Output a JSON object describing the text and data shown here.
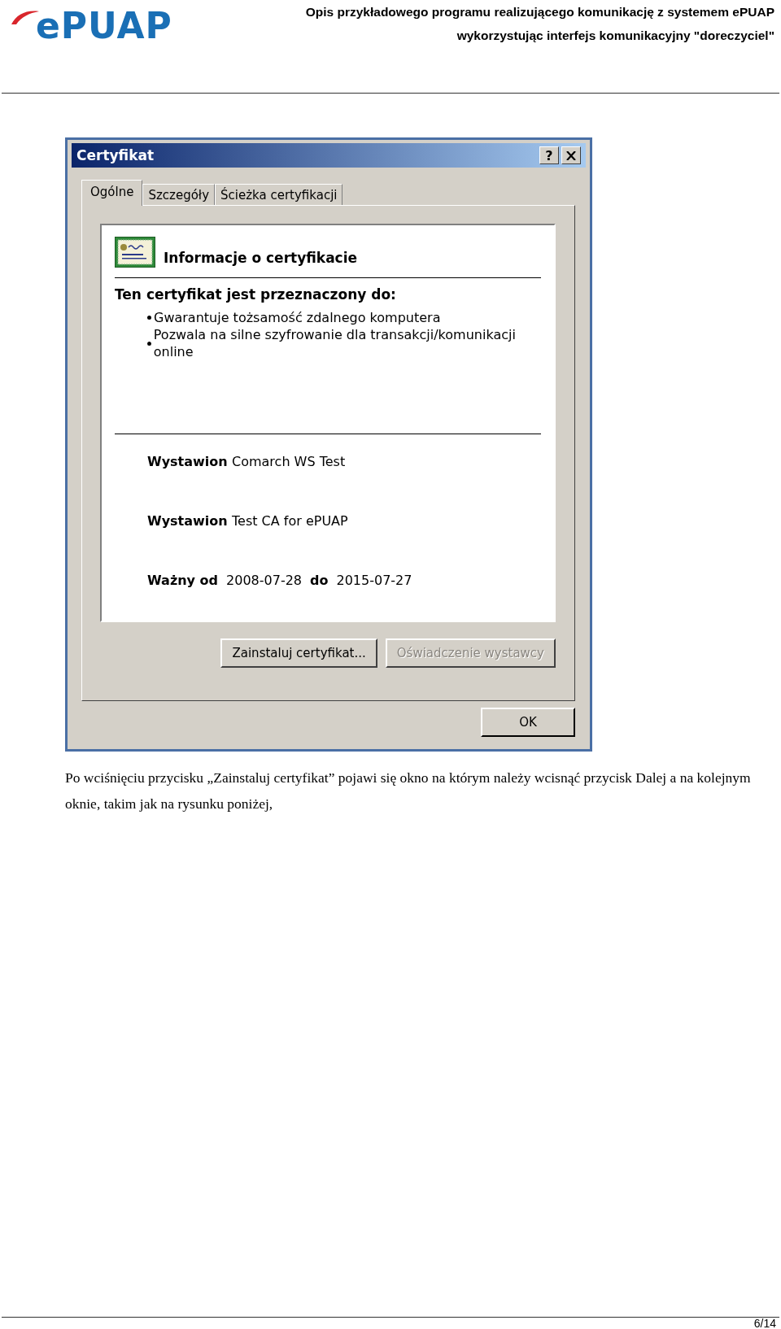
{
  "header": {
    "logo": "ePUAP",
    "title_lines": [
      "Opis przykładowego programu realizującego komunikację z systemem ePUAP",
      "wykorzystując interfejs komunikacyjny \"doreczyciel\""
    ]
  },
  "dialog": {
    "title": "Certyfikat",
    "help_button": "?",
    "tabs": [
      {
        "label": "Ogólne",
        "selected": true
      },
      {
        "label": "Szczegóły",
        "selected": false
      },
      {
        "label": "Ścieżka certyfikacji",
        "selected": false
      }
    ],
    "heading": "Informacje o certyfikacie",
    "purpose_heading": "Ten certyfikat jest przeznaczony do:",
    "purposes": [
      "Gwarantuje tożsamość zdalnego komputera",
      "Pozwala na silne szyfrowanie dla transakcji/komunikacji online"
    ],
    "fields": [
      {
        "label": "Wystawion",
        "value": "Comarch WS Test"
      },
      {
        "label": "Wystawion",
        "value": "Test CA for ePUAP"
      }
    ],
    "validity": {
      "from_label": "Ważny od",
      "from": "2008-07-28",
      "to_label": "do",
      "to": "2015-07-27"
    },
    "buttons": [
      {
        "label": "Zainstaluj certyfikat...",
        "disabled": false
      },
      {
        "label": "Oświadczenie wystawcy",
        "disabled": true
      }
    ],
    "ok_button": "OK"
  },
  "caption": "Po wciśnięciu przycisku „Zainstaluj certyfikat” pojawi się okno na którym należy wcisnąć przycisk Dalej a na kolejnym oknie, takim jak na rysunku poniżej,",
  "page_number": "6/14"
}
